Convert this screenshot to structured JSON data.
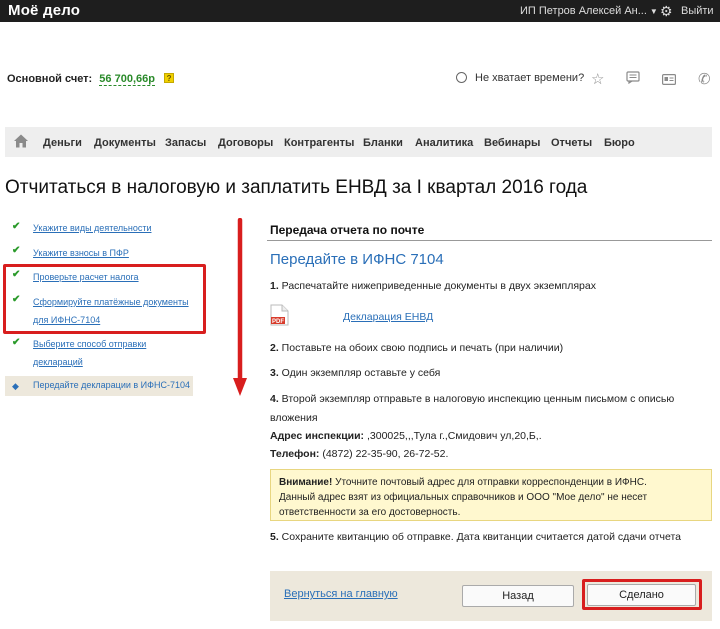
{
  "topbar": {
    "logo": "Моё дело",
    "user": "ИП Петров Алексей Ан...",
    "exit": "Выйти"
  },
  "account": {
    "label": "Основной счет:",
    "value": "56 700,66р",
    "help": "?"
  },
  "toolbar": {
    "no_time": "Не хватает времени?"
  },
  "menu": [
    "Деньги",
    "Документы",
    "Запасы",
    "Договоры",
    "Контрагенты",
    "Бланки",
    "Аналитика",
    "Вебинары",
    "Отчеты",
    "Бюро"
  ],
  "page": {
    "title": "Отчитаться в налоговую и заплатить ЕНВД за I квартал 2016 года"
  },
  "steps": {
    "s1": "Укажите виды деятельности",
    "s2": "Укажите взносы в ПФР",
    "s3": "Проверьте расчет налога",
    "s4a": "Сформируйте платёжные документы",
    "s4b": "для ИФНС-7104",
    "s5a": "Выберите способ отправки",
    "s5b": "деклараций",
    "s6": "Передайте декларации в ИФНС-7104"
  },
  "content": {
    "section_title": "Передача отчета по почте",
    "heading": "Передайте в ИФНС 7104",
    "p1_num": "1.",
    "p1": " Распечатайте нижеприведенные документы в двух экземплярах",
    "pdf_label": "PDF",
    "doc_link": "Декларация ЕНВД",
    "p2_num": "2.",
    "p2": " Поставьте на обоих свою подпись и печать (при наличии)",
    "p3_num": "3.",
    "p3": " Один экземпляр оставьте у себя",
    "p4_num": "4.",
    "p4a": " Второй экземпляр отправьте в налоговую инспекцию ценным письмом с описью",
    "p4b": "вложения",
    "addr_label": "Адрес инспекции:",
    "addr": " ,300025,,,Тула г.,Смидович ул,20,Б,.",
    "phone_label": "Телефон:",
    "phone": " (4872) 22-35-90, 26-72-52.",
    "notice_bold": "Внимание!",
    "notice_1": " Уточните почтовый адрес для отправки корреспонденции в ИФНС.",
    "notice_2": "Данный адрес взят из официальных справочников и ООО \"Мое дело\" не несет",
    "notice_3": "ответственности за его достоверность.",
    "p5_num": "5.",
    "p5": " Сохраните квитанцию об отправке. Дата квитанции считается датой сдачи отчета"
  },
  "footer": {
    "back_home": "Вернуться на главную",
    "back": "Назад",
    "done": "Сделано"
  },
  "colors": {
    "link": "#2a6fb8",
    "highlight": "#d81e1e",
    "check": "#2a9a2a",
    "notice_bg": "#fff8cf"
  }
}
